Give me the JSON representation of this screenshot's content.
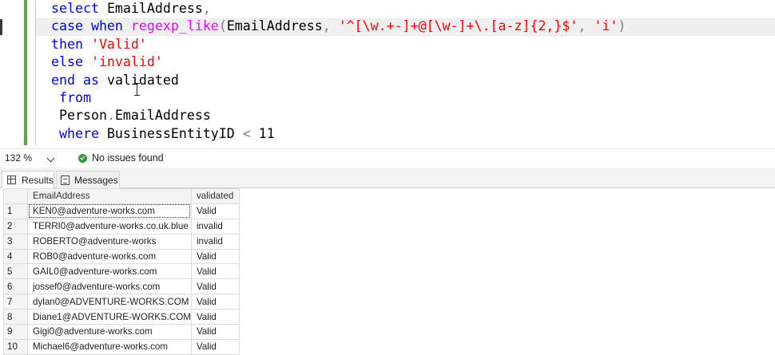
{
  "editor": {
    "lines": [
      [
        {
          "t": "select ",
          "c": "kw"
        },
        {
          "t": "EmailAddress",
          "c": "id"
        },
        {
          "t": ",",
          "c": "op"
        }
      ],
      [
        {
          "t": "case ",
          "c": "kw"
        },
        {
          "t": "when ",
          "c": "kw"
        },
        {
          "t": "regexp_like",
          "c": "fn"
        },
        {
          "t": "(",
          "c": "op"
        },
        {
          "t": "EmailAddress",
          "c": "id"
        },
        {
          "t": ", ",
          "c": "op"
        },
        {
          "t": "'^[\\w.+-]+@[\\w-]+\\.[a-z]{2,}$'",
          "c": "str"
        },
        {
          "t": ", ",
          "c": "op"
        },
        {
          "t": "'i'",
          "c": "str"
        },
        {
          "t": ")",
          "c": "op"
        }
      ],
      [
        {
          "t": "then ",
          "c": "kw"
        },
        {
          "t": "'Valid'",
          "c": "str"
        }
      ],
      [
        {
          "t": "else ",
          "c": "kw"
        },
        {
          "t": "'invalid'",
          "c": "str"
        }
      ],
      [
        {
          "t": "end ",
          "c": "kw"
        },
        {
          "t": "as ",
          "c": "kw"
        },
        {
          "t": "validated",
          "c": "id"
        }
      ],
      [
        {
          "t": " from",
          "c": "kw"
        }
      ],
      [
        {
          "t": " Person",
          "c": "id"
        },
        {
          "t": ".",
          "c": "op"
        },
        {
          "t": "EmailAddress",
          "c": "id"
        }
      ],
      [
        {
          "t": " where ",
          "c": "kw"
        },
        {
          "t": "BusinessEntityID ",
          "c": "id"
        },
        {
          "t": "< ",
          "c": "op"
        },
        {
          "t": "11",
          "c": "id"
        }
      ]
    ]
  },
  "status": {
    "zoom": "132 %",
    "issues": "No issues found"
  },
  "tabs": {
    "results": "Results",
    "messages": "Messages"
  },
  "grid": {
    "columns": [
      "",
      "EmailAddress",
      "validated"
    ],
    "rows": [
      {
        "n": "1",
        "email": "KEN0@adventure-works.com",
        "validated": "Valid"
      },
      {
        "n": "2",
        "email": "TERRI0@adventure-works.co.uk.blue",
        "validated": "invalid"
      },
      {
        "n": "3",
        "email": "ROBERTO@adventure-works",
        "validated": "invalid"
      },
      {
        "n": "4",
        "email": "ROB0@adventure-works.com",
        "validated": "Valid"
      },
      {
        "n": "5",
        "email": "GAIL0@adventure-works.com",
        "validated": "Valid"
      },
      {
        "n": "6",
        "email": "jossef0@adventure-works.com",
        "validated": "Valid"
      },
      {
        "n": "7",
        "email": "dylan0@ADVENTURE-WORKS.COM",
        "validated": "Valid"
      },
      {
        "n": "8",
        "email": "Diane1@ADVENTURE-WORKS.COM",
        "validated": "Valid"
      },
      {
        "n": "9",
        "email": "Gigi0@adventure-works.com",
        "validated": "Valid"
      },
      {
        "n": "10",
        "email": "Michael6@adventure-works.com",
        "validated": "Valid"
      }
    ]
  }
}
